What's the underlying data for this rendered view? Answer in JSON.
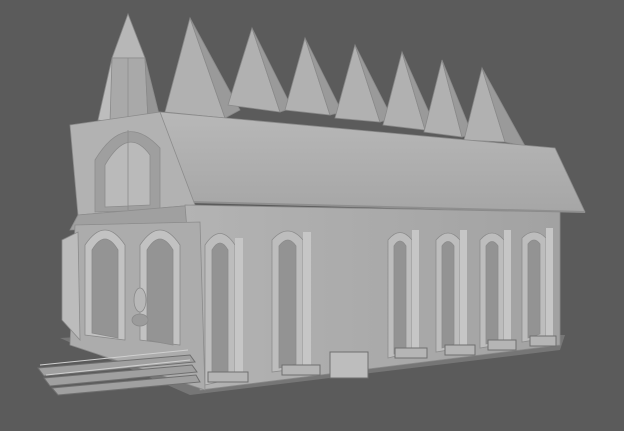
{
  "viewport": {
    "background": "#5b5b5b",
    "model_base_color": "#a8a8a8",
    "model_light_color": "#c4c4c4",
    "model_shadow_color": "#7d7d7d"
  }
}
